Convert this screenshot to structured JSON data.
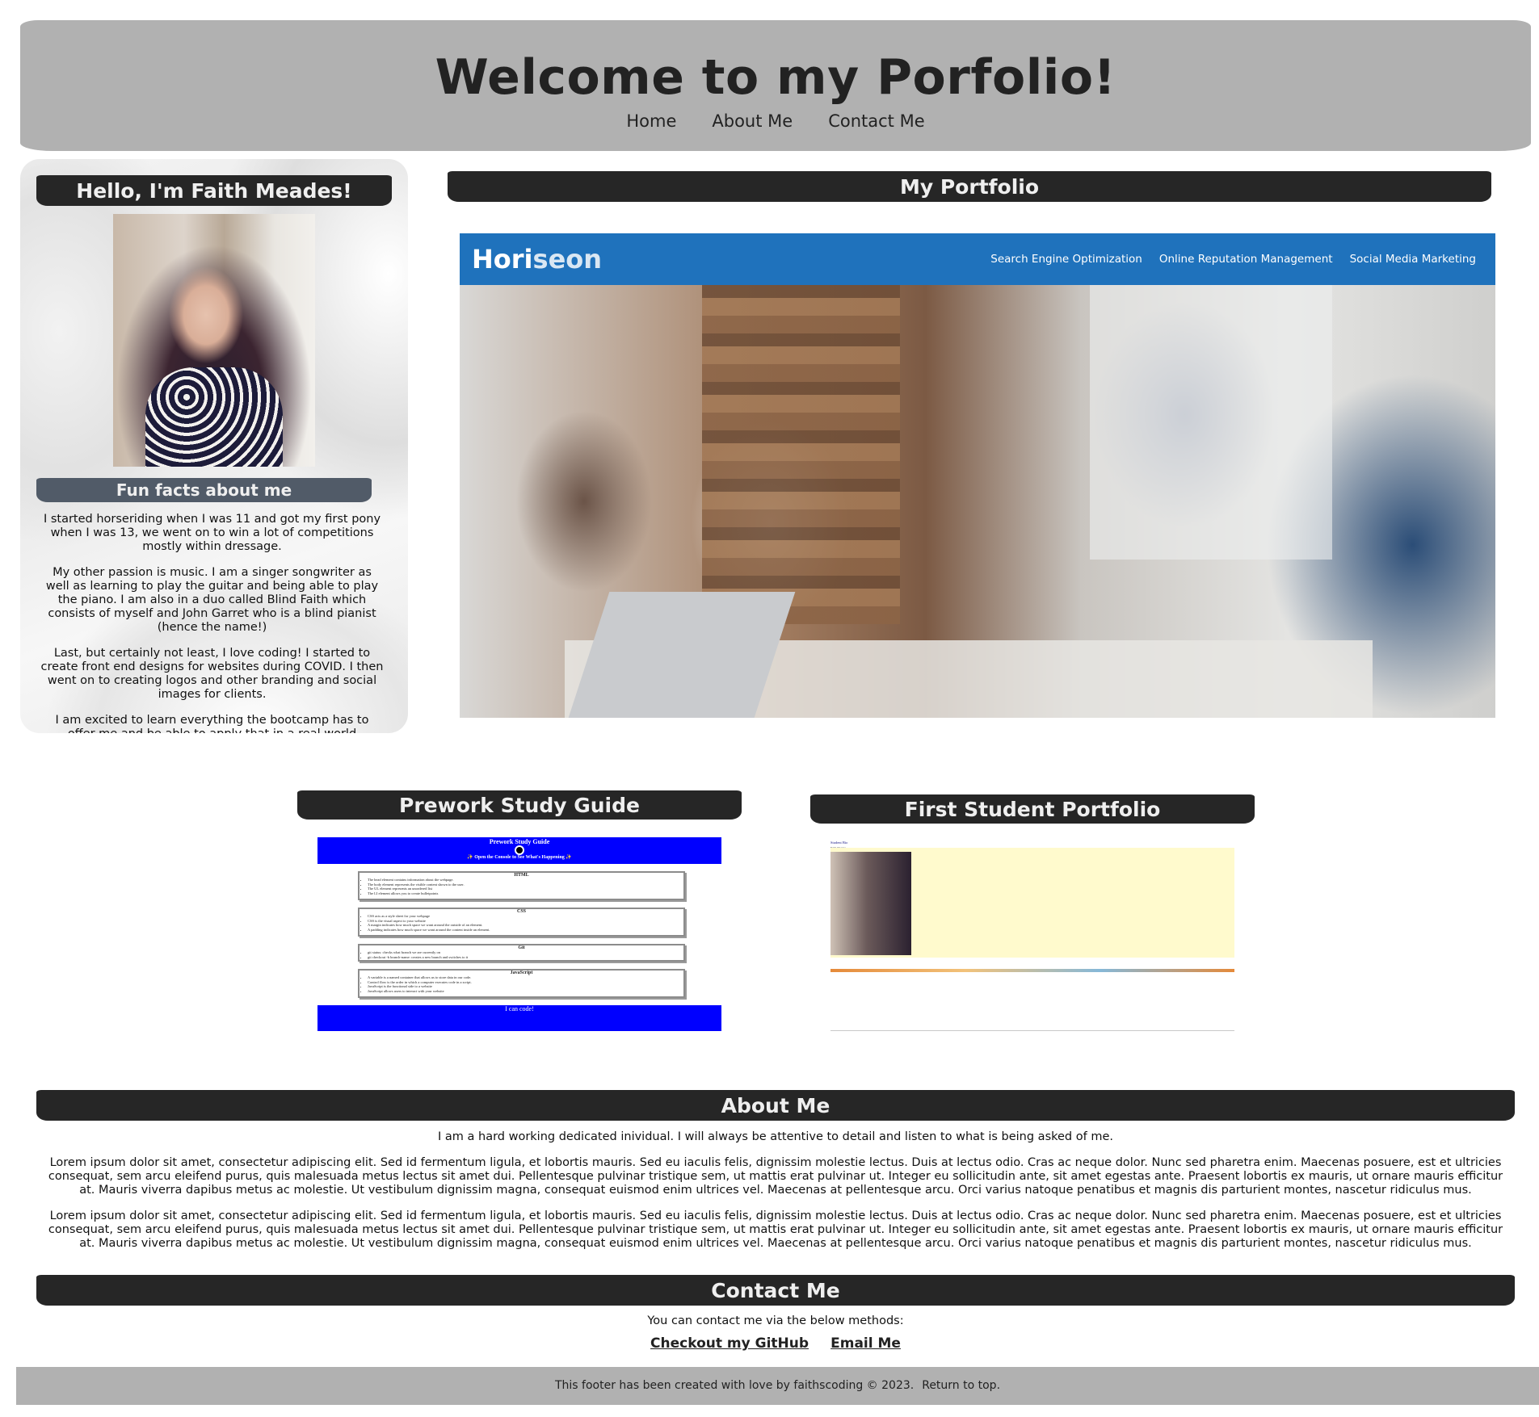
{
  "header": {
    "title": "Welcome to my Porfolio!",
    "nav": [
      "Home",
      "About Me",
      "Contact Me"
    ]
  },
  "sidebar": {
    "hello": "Hello, I'm Faith Meades!",
    "funfacts_title": "Fun facts about me",
    "paragraphs": [
      "I started horseriding when I was 11 and got my first pony when I was 13, we went on to win a lot of competitions mostly within dressage.",
      "My other passion is music. I am a singer songwriter as well as learning to play the guitar and being able to play the piano. I am also in a duo called Blind Faith which consists of myself and John Garret who is a blind pianist (hence the name!)",
      "Last, but certainly not least, I love coding! I started to create front end designs for websites during COVID. I then went on to creating logos and other branding and social images for clients.",
      "I am excited to learn everything the bootcamp has to offer me and be able to apply that in a real world situation"
    ]
  },
  "portfolio": {
    "title": "My Portfolio",
    "horiseon": {
      "logo_a": "Hori",
      "logo_b": "seon",
      "nav": [
        "Search Engine Optimization",
        "Online Reputation Management",
        "Social Media Marketing"
      ]
    },
    "prework": {
      "title": "Prework Study Guide",
      "shot": {
        "heading": "Prework Study Guide",
        "subheading": "✨ Open the Console to See What's Happening ✨",
        "sections": [
          {
            "name": "HTML",
            "items": [
              "The head element contains information about the webpage.",
              "The body element represents the visible content shown to the user.",
              "The UL element represents an unordered list",
              "The LI element allows you to create bulletpoints"
            ]
          },
          {
            "name": "CSS",
            "items": [
              "CSS acts as a style sheet for your webpage",
              "CSS is the visual aspect to your website",
              "A margin indicates how much space we want around the outside of an element.",
              "A padding indicates how much space we want around the content inside an element."
            ]
          },
          {
            "name": "Git",
            "items": [
              "git status: checks what branch we are currently on",
              "git checkout -b branch-name: creates a new branch and switches to it"
            ]
          },
          {
            "name": "JavaScript",
            "items": [
              "A variable is a named container that allows us to store data in our code.",
              "Control flow is the order in which a computer executes code in a script.",
              "JavaScript is the functional side to a website",
              "JavaScript allows users to interact with your website"
            ]
          }
        ],
        "footer": "I can code!"
      }
    },
    "student": {
      "title": "First Student Portfolio",
      "shot": {
        "heading": "Student Bio",
        "sub": "Faith Meades"
      }
    }
  },
  "about": {
    "title": "About Me",
    "intro": "I am a hard working dedicated inividual. I will always be attentive to detail and listen to what is being asked of me.",
    "paragraphs": [
      "Lorem ipsum dolor sit amet, consectetur adipiscing elit. Sed id fermentum ligula, et lobortis mauris. Sed eu iaculis felis, dignissim molestie lectus. Duis at lectus odio. Cras ac neque dolor. Nunc sed pharetra enim. Maecenas posuere, est et ultricies consequat, sem arcu eleifend purus, quis malesuada metus lectus sit amet dui. Pellentesque pulvinar tristique sem, ut mattis erat pulvinar ut. Integer eu sollicitudin ante, sit amet egestas ante. Praesent lobortis ex mauris, ut ornare mauris efficitur at. Mauris viverra dapibus metus ac molestie. Ut vestibulum dignissim magna, consequat euismod enim ultrices vel. Maecenas at pellentesque arcu. Orci varius natoque penatibus et magnis dis parturient montes, nascetur ridiculus mus.",
      "Lorem ipsum dolor sit amet, consectetur adipiscing elit. Sed id fermentum ligula, et lobortis mauris. Sed eu iaculis felis, dignissim molestie lectus. Duis at lectus odio. Cras ac neque dolor. Nunc sed pharetra enim. Maecenas posuere, est et ultricies consequat, sem arcu eleifend purus, quis malesuada metus lectus sit amet dui. Pellentesque pulvinar tristique sem, ut mattis erat pulvinar ut. Integer eu sollicitudin ante, sit amet egestas ante. Praesent lobortis ex mauris, ut ornare mauris efficitur at. Mauris viverra dapibus metus ac molestie. Ut vestibulum dignissim magna, consequat euismod enim ultrices vel. Maecenas at pellentesque arcu. Orci varius natoque penatibus et magnis dis parturient montes, nascetur ridiculus mus."
    ]
  },
  "contact": {
    "title": "Contact Me",
    "intro": "You can contact me via the below methods:",
    "github": "Checkout my GitHub",
    "email": "Email Me"
  },
  "footer": {
    "text": "This footer has been created with love by faithscoding © 2023.",
    "top_link": "Return to top."
  },
  "colors": {
    "header_bg": "#b1b1b1",
    "title_bar": "#262626",
    "funfacts_bar": "#515b68",
    "horiseon_blue": "#1f72bc",
    "prework_blue": "#0000ff"
  }
}
